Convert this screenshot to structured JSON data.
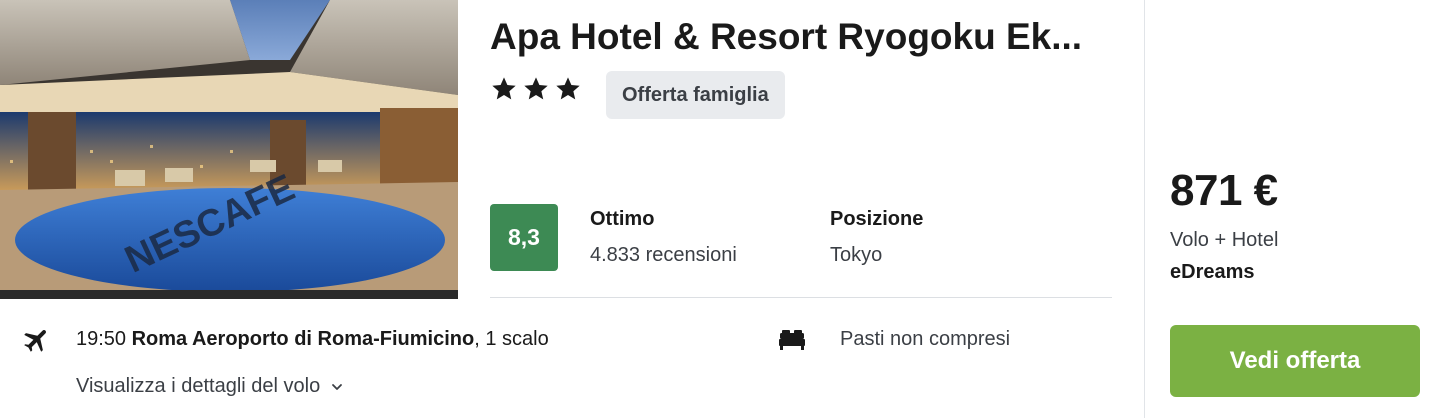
{
  "hotel": {
    "name": "Apa Hotel & Resort Ryogoku Ek...",
    "stars": 3,
    "badge": "Offerta famiglia",
    "photo_text": "NESCAFE"
  },
  "rating": {
    "score": "8,3",
    "label": "Ottimo",
    "reviews": "4.833 recensioni",
    "score_color": "#3d8a54"
  },
  "location": {
    "label": "Posizione",
    "value": "Tokyo"
  },
  "flight": {
    "time": "19:50",
    "airport": "Roma Aeroporto di Roma-Fiumicino",
    "stops": ", 1 scalo",
    "details_link": "Visualizza i dettagli del volo"
  },
  "meals": {
    "text": "Pasti non compresi"
  },
  "offer": {
    "price": "871 €",
    "package": "Volo + Hotel",
    "provider": "eDreams",
    "cta_label": "Vedi offerta",
    "cta_color": "#7bb143"
  },
  "icons": {
    "plane": "plane-icon",
    "bed": "bed-icon",
    "star": "star-icon",
    "chevron": "chevron-down-icon"
  }
}
